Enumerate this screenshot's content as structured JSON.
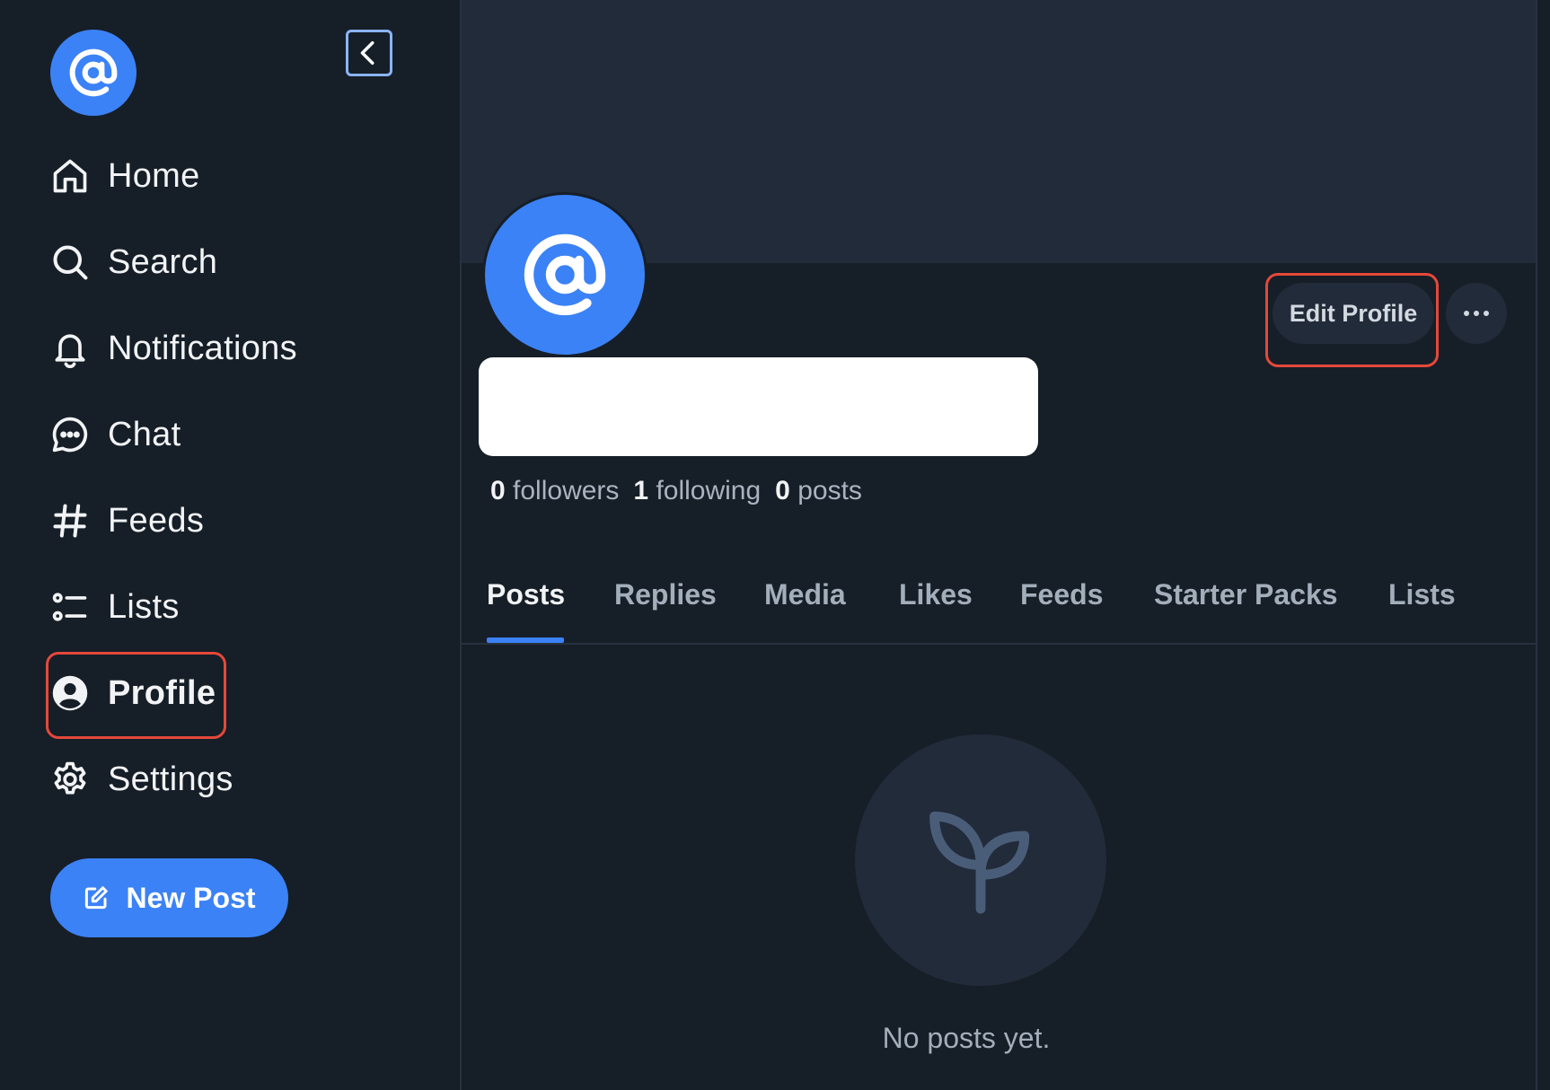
{
  "sidebar": {
    "items": [
      {
        "label": "Home",
        "icon": "home-icon"
      },
      {
        "label": "Search",
        "icon": "search-icon"
      },
      {
        "label": "Notifications",
        "icon": "bell-icon"
      },
      {
        "label": "Chat",
        "icon": "chat-icon"
      },
      {
        "label": "Feeds",
        "icon": "hash-icon"
      },
      {
        "label": "Lists",
        "icon": "list-icon"
      },
      {
        "label": "Profile",
        "icon": "user-circle-icon",
        "active": true
      },
      {
        "label": "Settings",
        "icon": "gear-icon"
      }
    ],
    "new_post_label": "New Post"
  },
  "profile": {
    "stats": {
      "followers_count": "0",
      "followers_label": "followers",
      "following_count": "1",
      "following_label": "following",
      "posts_count": "0",
      "posts_label": "posts"
    },
    "edit_label": "Edit Profile"
  },
  "tabs": [
    {
      "label": "Posts",
      "active": true
    },
    {
      "label": "Replies"
    },
    {
      "label": "Media"
    },
    {
      "label": "Likes"
    },
    {
      "label": "Feeds"
    },
    {
      "label": "Starter Packs"
    },
    {
      "label": "Lists"
    }
  ],
  "empty_state": {
    "icon": "sprout-icon",
    "text": "No posts yet."
  },
  "colors": {
    "accent": "#3b82f6",
    "background": "#161e27",
    "surface": "#222b3a",
    "highlight": "#e5483b"
  }
}
